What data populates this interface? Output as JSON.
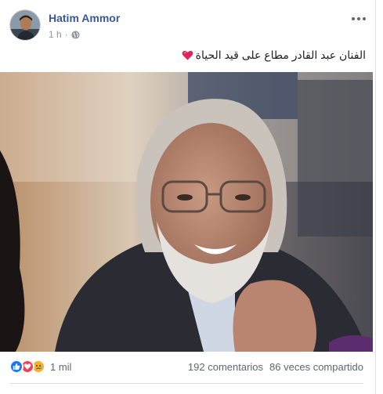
{
  "post": {
    "author": "Hatim Ammor",
    "timestamp": "1 h",
    "separator": "·",
    "privacy_icon": "globe-icon",
    "message": "الفنان عبد القادر مطاع على قيد الحياة",
    "message_emoji": "red-heart-emoji",
    "photo_description_icon": "portrait-photo"
  },
  "reactions": {
    "types": [
      "like-icon",
      "love-icon",
      "sad-icon"
    ],
    "count": "1 mil",
    "comments": "192 comentarios",
    "shares": "86 veces compartido"
  },
  "colors": {
    "author": "#385898",
    "like": "#1877f2",
    "love": "#f33e58",
    "sad": "#f7b125",
    "meta": "#90949c"
  }
}
